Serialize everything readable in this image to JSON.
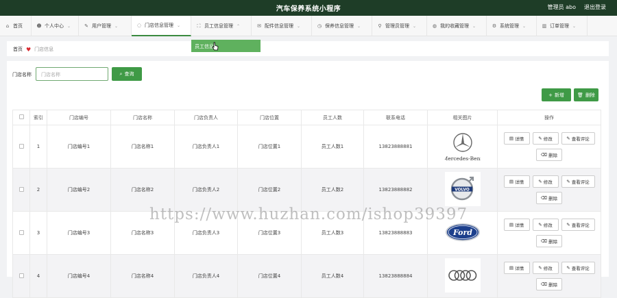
{
  "header": {
    "title": "汽车保养系统小程序",
    "user": "管理员 abo",
    "logout": "退出登录"
  },
  "nav": {
    "items": [
      {
        "label": "首页",
        "icon": "⌂"
      },
      {
        "label": "个人中心",
        "icon": "☻"
      },
      {
        "label": "用户管理",
        "icon": "✎"
      },
      {
        "label": "门店信息管理",
        "icon": "◌"
      },
      {
        "label": "员工信息管理",
        "icon": "⛶"
      },
      {
        "label": "配件信息管理",
        "icon": "✉"
      },
      {
        "label": "保养信息管理",
        "icon": "◷"
      },
      {
        "label": "管理员管理",
        "icon": "⚲"
      },
      {
        "label": "我的收藏管理",
        "icon": "◍"
      },
      {
        "label": "系统管理",
        "icon": "⚙"
      },
      {
        "label": "订单管理",
        "icon": "▥"
      }
    ],
    "dropdown_item": "员工信息"
  },
  "breadcrumb": {
    "home": "首页",
    "current": "门店信息"
  },
  "search": {
    "label": "门店名称",
    "placeholder": "门店名称",
    "button": "查询"
  },
  "toolbar": {
    "add": "新增",
    "delete": "删除"
  },
  "table": {
    "headers": [
      "",
      "索引",
      "门店编号",
      "门店名称",
      "门店负责人",
      "门店位置",
      "员工人数",
      "联系电话",
      "相关图片",
      "操作"
    ],
    "rows": [
      {
        "index": "1",
        "no": "门店编号1",
        "name": "门店名称1",
        "manager": "门店负责人1",
        "location": "门店位置1",
        "staff": "员工人数1",
        "phone": "13823888881",
        "logo": "mercedes-benz-logo",
        "logo_text": "Mercedes-Benz"
      },
      {
        "index": "2",
        "no": "门店编号2",
        "name": "门店名称2",
        "manager": "门店负责人2",
        "location": "门店位置2",
        "staff": "员工人数2",
        "phone": "13823888882",
        "logo": "volvo-logo",
        "logo_text": "VOLVO"
      },
      {
        "index": "3",
        "no": "门店编号3",
        "name": "门店名称3",
        "manager": "门店负责人3",
        "location": "门店位置3",
        "staff": "员工人数3",
        "phone": "13823888883",
        "logo": "ford-logo",
        "logo_text": "Ford"
      },
      {
        "index": "4",
        "no": "门店编号4",
        "name": "门店名称4",
        "manager": "门店负责人4",
        "location": "门店位置4",
        "staff": "员工人数4",
        "phone": "13823888884",
        "logo": "audi-logo",
        "logo_text": ""
      }
    ],
    "actions": {
      "detail": "详情",
      "edit": "修改",
      "reviews": "查看评论",
      "delete": "删除"
    }
  },
  "watermark": "https://www.huzhan.com/ishop39397",
  "colors": {
    "topbar": "#1e3d27",
    "accent": "#3f9a46",
    "dropdown": "#5fb15e",
    "heart": "#d9282f"
  }
}
